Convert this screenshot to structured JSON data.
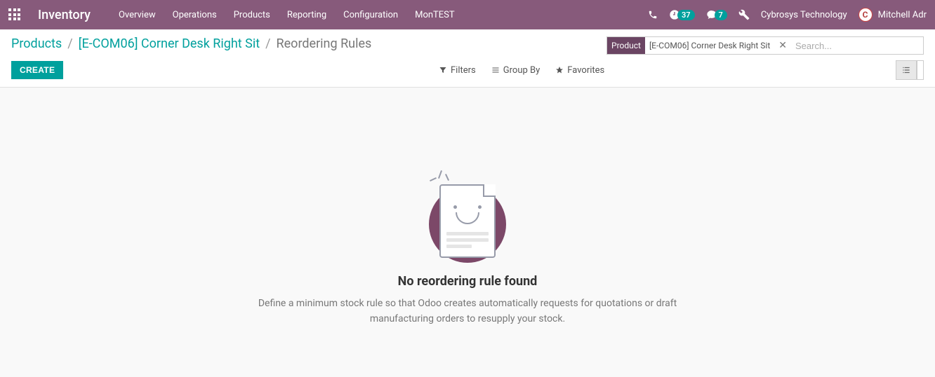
{
  "navbar": {
    "brand": "Inventory",
    "menu": [
      "Overview",
      "Operations",
      "Products",
      "Reporting",
      "Configuration",
      "MonTEST"
    ],
    "badges": {
      "activities": "37",
      "messages": "7"
    },
    "company": "Cybrosys Technology",
    "user": "Mitchell Adr",
    "avatar_letter": "C"
  },
  "breadcrumb": {
    "items": [
      "Products",
      "[E-COM06] Corner Desk Right Sit"
    ],
    "current": "Reordering Rules"
  },
  "search": {
    "facet_label": "Product",
    "facet_value": "[E-COM06] Corner Desk Right Sit",
    "placeholder": "Search..."
  },
  "buttons": {
    "create": "CREATE"
  },
  "search_options": {
    "filters": "Filters",
    "group_by": "Group By",
    "favorites": "Favorites"
  },
  "empty_state": {
    "title": "No reordering rule found",
    "description": "Define a minimum stock rule so that Odoo creates automatically requests for quotations or draft manufacturing orders to resupply your stock."
  }
}
